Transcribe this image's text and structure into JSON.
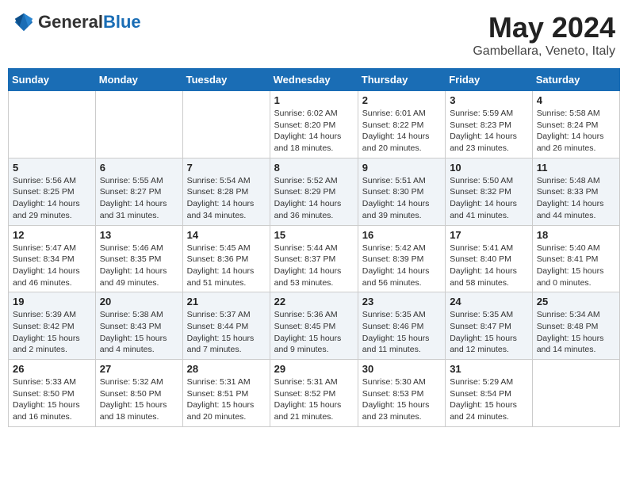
{
  "header": {
    "logo_general": "General",
    "logo_blue": "Blue",
    "title": "May 2024",
    "location": "Gambellara, Veneto, Italy"
  },
  "weekdays": [
    "Sunday",
    "Monday",
    "Tuesday",
    "Wednesday",
    "Thursday",
    "Friday",
    "Saturday"
  ],
  "weeks": [
    [
      {
        "day": "",
        "info": ""
      },
      {
        "day": "",
        "info": ""
      },
      {
        "day": "",
        "info": ""
      },
      {
        "day": "1",
        "info": "Sunrise: 6:02 AM\nSunset: 8:20 PM\nDaylight: 14 hours\nand 18 minutes."
      },
      {
        "day": "2",
        "info": "Sunrise: 6:01 AM\nSunset: 8:22 PM\nDaylight: 14 hours\nand 20 minutes."
      },
      {
        "day": "3",
        "info": "Sunrise: 5:59 AM\nSunset: 8:23 PM\nDaylight: 14 hours\nand 23 minutes."
      },
      {
        "day": "4",
        "info": "Sunrise: 5:58 AM\nSunset: 8:24 PM\nDaylight: 14 hours\nand 26 minutes."
      }
    ],
    [
      {
        "day": "5",
        "info": "Sunrise: 5:56 AM\nSunset: 8:25 PM\nDaylight: 14 hours\nand 29 minutes."
      },
      {
        "day": "6",
        "info": "Sunrise: 5:55 AM\nSunset: 8:27 PM\nDaylight: 14 hours\nand 31 minutes."
      },
      {
        "day": "7",
        "info": "Sunrise: 5:54 AM\nSunset: 8:28 PM\nDaylight: 14 hours\nand 34 minutes."
      },
      {
        "day": "8",
        "info": "Sunrise: 5:52 AM\nSunset: 8:29 PM\nDaylight: 14 hours\nand 36 minutes."
      },
      {
        "day": "9",
        "info": "Sunrise: 5:51 AM\nSunset: 8:30 PM\nDaylight: 14 hours\nand 39 minutes."
      },
      {
        "day": "10",
        "info": "Sunrise: 5:50 AM\nSunset: 8:32 PM\nDaylight: 14 hours\nand 41 minutes."
      },
      {
        "day": "11",
        "info": "Sunrise: 5:48 AM\nSunset: 8:33 PM\nDaylight: 14 hours\nand 44 minutes."
      }
    ],
    [
      {
        "day": "12",
        "info": "Sunrise: 5:47 AM\nSunset: 8:34 PM\nDaylight: 14 hours\nand 46 minutes."
      },
      {
        "day": "13",
        "info": "Sunrise: 5:46 AM\nSunset: 8:35 PM\nDaylight: 14 hours\nand 49 minutes."
      },
      {
        "day": "14",
        "info": "Sunrise: 5:45 AM\nSunset: 8:36 PM\nDaylight: 14 hours\nand 51 minutes."
      },
      {
        "day": "15",
        "info": "Sunrise: 5:44 AM\nSunset: 8:37 PM\nDaylight: 14 hours\nand 53 minutes."
      },
      {
        "day": "16",
        "info": "Sunrise: 5:42 AM\nSunset: 8:39 PM\nDaylight: 14 hours\nand 56 minutes."
      },
      {
        "day": "17",
        "info": "Sunrise: 5:41 AM\nSunset: 8:40 PM\nDaylight: 14 hours\nand 58 minutes."
      },
      {
        "day": "18",
        "info": "Sunrise: 5:40 AM\nSunset: 8:41 PM\nDaylight: 15 hours\nand 0 minutes."
      }
    ],
    [
      {
        "day": "19",
        "info": "Sunrise: 5:39 AM\nSunset: 8:42 PM\nDaylight: 15 hours\nand 2 minutes."
      },
      {
        "day": "20",
        "info": "Sunrise: 5:38 AM\nSunset: 8:43 PM\nDaylight: 15 hours\nand 4 minutes."
      },
      {
        "day": "21",
        "info": "Sunrise: 5:37 AM\nSunset: 8:44 PM\nDaylight: 15 hours\nand 7 minutes."
      },
      {
        "day": "22",
        "info": "Sunrise: 5:36 AM\nSunset: 8:45 PM\nDaylight: 15 hours\nand 9 minutes."
      },
      {
        "day": "23",
        "info": "Sunrise: 5:35 AM\nSunset: 8:46 PM\nDaylight: 15 hours\nand 11 minutes."
      },
      {
        "day": "24",
        "info": "Sunrise: 5:35 AM\nSunset: 8:47 PM\nDaylight: 15 hours\nand 12 minutes."
      },
      {
        "day": "25",
        "info": "Sunrise: 5:34 AM\nSunset: 8:48 PM\nDaylight: 15 hours\nand 14 minutes."
      }
    ],
    [
      {
        "day": "26",
        "info": "Sunrise: 5:33 AM\nSunset: 8:50 PM\nDaylight: 15 hours\nand 16 minutes."
      },
      {
        "day": "27",
        "info": "Sunrise: 5:32 AM\nSunset: 8:50 PM\nDaylight: 15 hours\nand 18 minutes."
      },
      {
        "day": "28",
        "info": "Sunrise: 5:31 AM\nSunset: 8:51 PM\nDaylight: 15 hours\nand 20 minutes."
      },
      {
        "day": "29",
        "info": "Sunrise: 5:31 AM\nSunset: 8:52 PM\nDaylight: 15 hours\nand 21 minutes."
      },
      {
        "day": "30",
        "info": "Sunrise: 5:30 AM\nSunset: 8:53 PM\nDaylight: 15 hours\nand 23 minutes."
      },
      {
        "day": "31",
        "info": "Sunrise: 5:29 AM\nSunset: 8:54 PM\nDaylight: 15 hours\nand 24 minutes."
      },
      {
        "day": "",
        "info": ""
      }
    ]
  ]
}
